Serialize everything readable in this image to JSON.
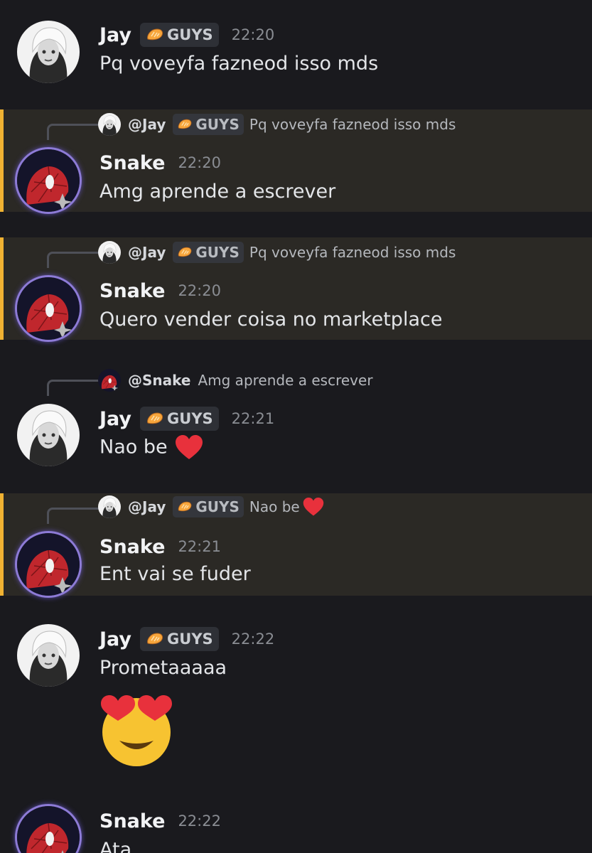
{
  "messages": [
    {
      "author": "Jay",
      "tag": "GUYS",
      "time": "22:20",
      "text": "Pq voveyfa fazneod isso mds"
    },
    {
      "author": "Snake",
      "time": "22:20",
      "text": "Amg aprende a escrever",
      "reply": {
        "author": "@Jay",
        "tag": "GUYS",
        "text": "Pq voveyfa fazneod isso mds"
      }
    },
    {
      "author": "Snake",
      "time": "22:20",
      "text": "Quero vender coisa no marketplace",
      "reply": {
        "author": "@Jay",
        "tag": "GUYS",
        "text": "Pq voveyfa fazneod isso mds"
      }
    },
    {
      "author": "Jay",
      "tag": "GUYS",
      "time": "22:21",
      "text": "Nao be",
      "reply": {
        "author": "@Snake",
        "text": "Amg aprende a escrever"
      }
    },
    {
      "author": "Snake",
      "time": "22:21",
      "text": "Ent vai se fuder",
      "reply": {
        "author": "@Jay",
        "tag": "GUYS",
        "text": "Nao be"
      }
    },
    {
      "author": "Jay",
      "tag": "GUYS",
      "time": "22:22",
      "text": "Prometaaaaa",
      "emoji": "heart-eyes-emoji"
    },
    {
      "author": "Snake",
      "time": "22:22",
      "text": "Ata"
    }
  ],
  "colors": {
    "background": "#1a1a1e",
    "mention_bg": "#2b2925",
    "mention_bar": "#f0b232",
    "heart": "#e8313c"
  },
  "icons": {
    "tag": "bread-icon",
    "heart": "heart-emoji"
  }
}
